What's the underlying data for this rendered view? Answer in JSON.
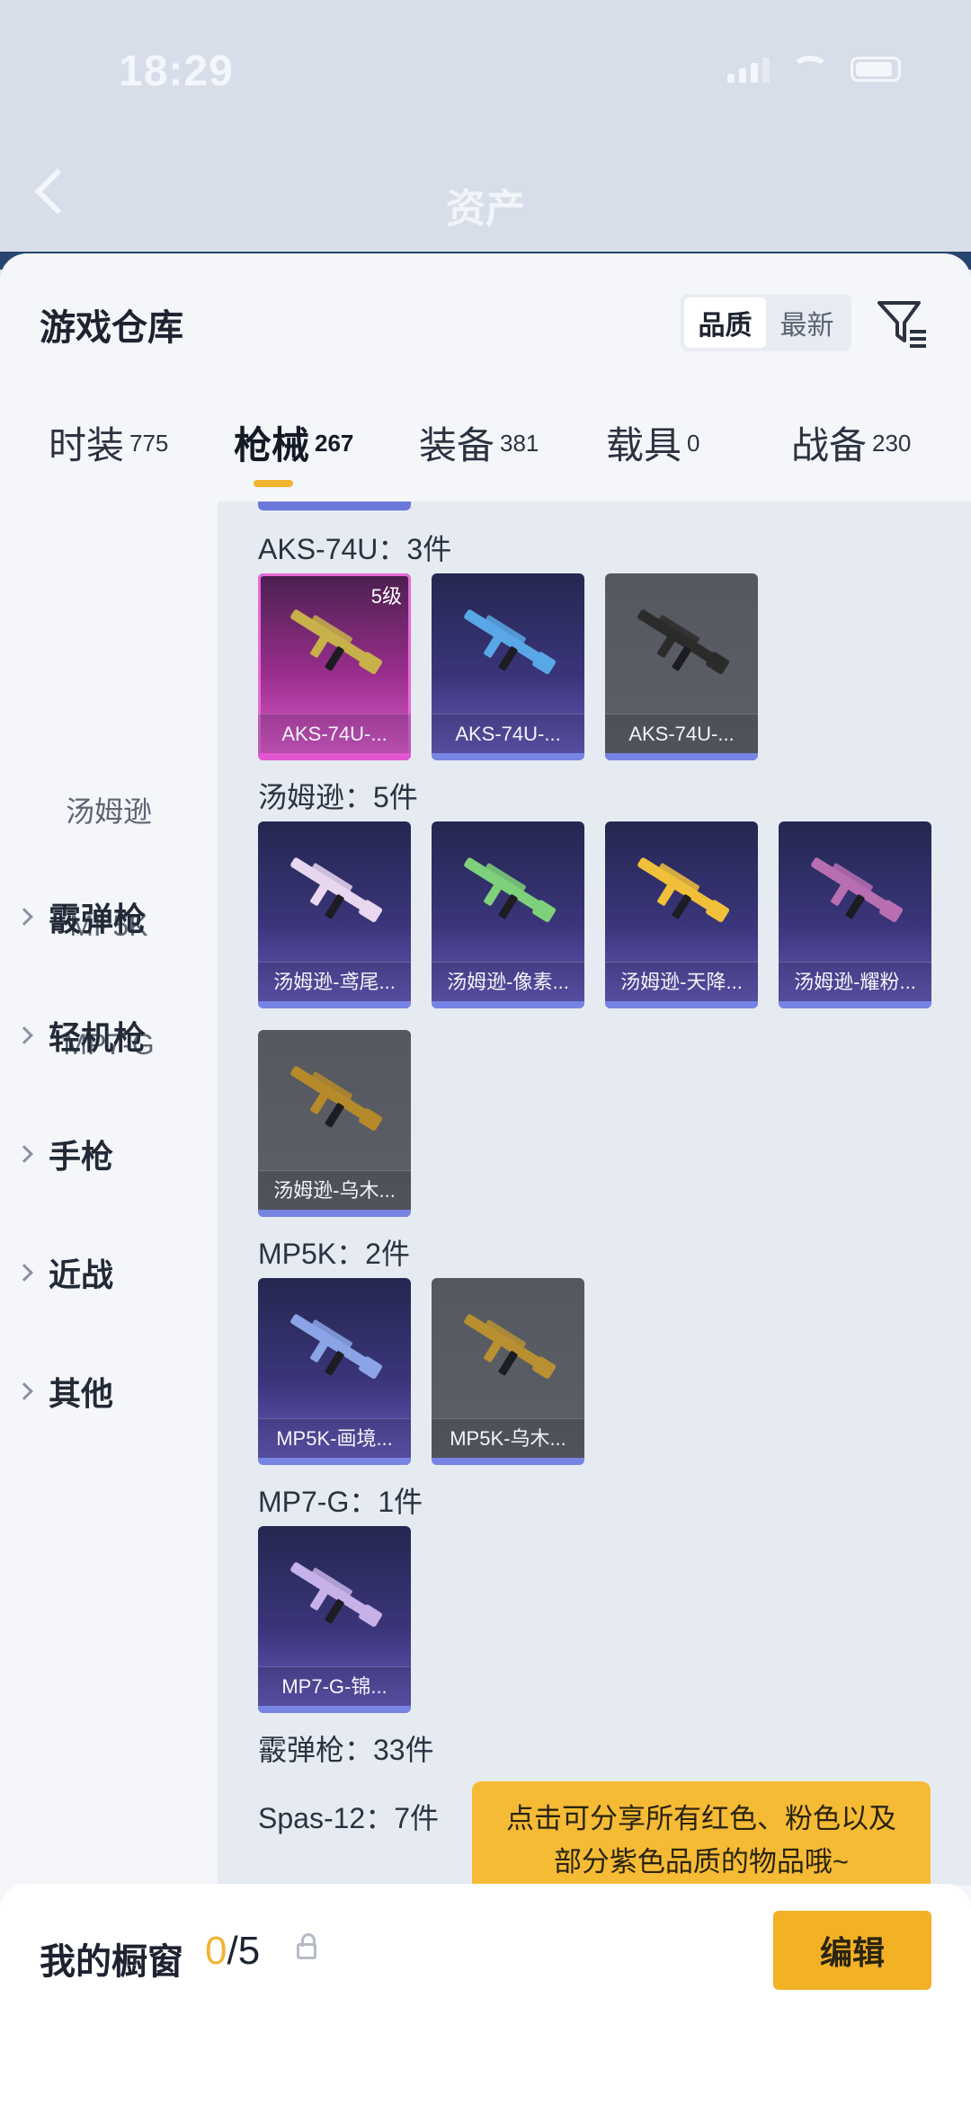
{
  "status_bar": {
    "time": "18:29"
  },
  "header": {
    "title": "资产"
  },
  "sheet": {
    "title": "游戏仓库",
    "sort": {
      "options": [
        "品质",
        "最新"
      ],
      "selected": "品质"
    },
    "tabs": [
      {
        "label": "时装",
        "count": "775"
      },
      {
        "label": "枪械",
        "count": "267",
        "active": true
      },
      {
        "label": "装备",
        "count": "381"
      },
      {
        "label": "载具",
        "count": "0"
      },
      {
        "label": "战备",
        "count": "230"
      }
    ]
  },
  "sidebar": {
    "subitems": [
      "汤姆逊",
      "MP5K",
      "MP7-G"
    ],
    "categories": [
      "霰弹枪",
      "轻机枪",
      "手枪",
      "近战",
      "其他"
    ]
  },
  "groups": [
    {
      "title": "AKS-74U：3件",
      "items": [
        {
          "label": "AKS-74U-...",
          "rarity": "pink",
          "level": "5级",
          "gun_color": "#c8b04a"
        },
        {
          "label": "AKS-74U-...",
          "rarity": "purple",
          "gun_color": "#5aa7e8"
        },
        {
          "label": "AKS-74U-...",
          "rarity": "grey",
          "gun_color": "#2b2b2b"
        }
      ]
    },
    {
      "title": "汤姆逊：5件",
      "items": [
        {
          "label": "汤姆逊-鸢尾...",
          "rarity": "purple",
          "gun_color": "#e9d7f0"
        },
        {
          "label": "汤姆逊-像素...",
          "rarity": "purple",
          "gun_color": "#7fd07a"
        },
        {
          "label": "汤姆逊-天降...",
          "rarity": "purple",
          "gun_color": "#f0c03a"
        },
        {
          "label": "汤姆逊-耀粉...",
          "rarity": "purple",
          "gun_color": "#b76fb2"
        },
        {
          "label": "汤姆逊-乌木...",
          "rarity": "grey",
          "gun_color": "#b68a2a"
        }
      ]
    },
    {
      "title": "MP5K：2件",
      "items": [
        {
          "label": "MP5K-画境...",
          "rarity": "purple",
          "gun_color": "#8aa4e6"
        },
        {
          "label": "MP5K-乌木...",
          "rarity": "grey",
          "gun_color": "#b89032"
        }
      ]
    },
    {
      "title": "MP7-G：1件",
      "items": [
        {
          "label": "MP7-G-锦...",
          "rarity": "purple",
          "gun_color": "#c6b2e8"
        }
      ]
    },
    {
      "title": "霰弹枪：33件",
      "items": []
    },
    {
      "title": "Spas-12：7件",
      "items": []
    }
  ],
  "tooltip": {
    "line1": "点击可分享所有红色、粉色以及",
    "line2": "部分紫色品质的物品哦~"
  },
  "showcase": {
    "title": "我的橱窗",
    "current": "0",
    "total": "/5",
    "edit_label": "编辑"
  },
  "colors": {
    "accent": "#f3b126",
    "pink_rarity": "#e257d0",
    "purple_rarity": "#7784e4"
  }
}
